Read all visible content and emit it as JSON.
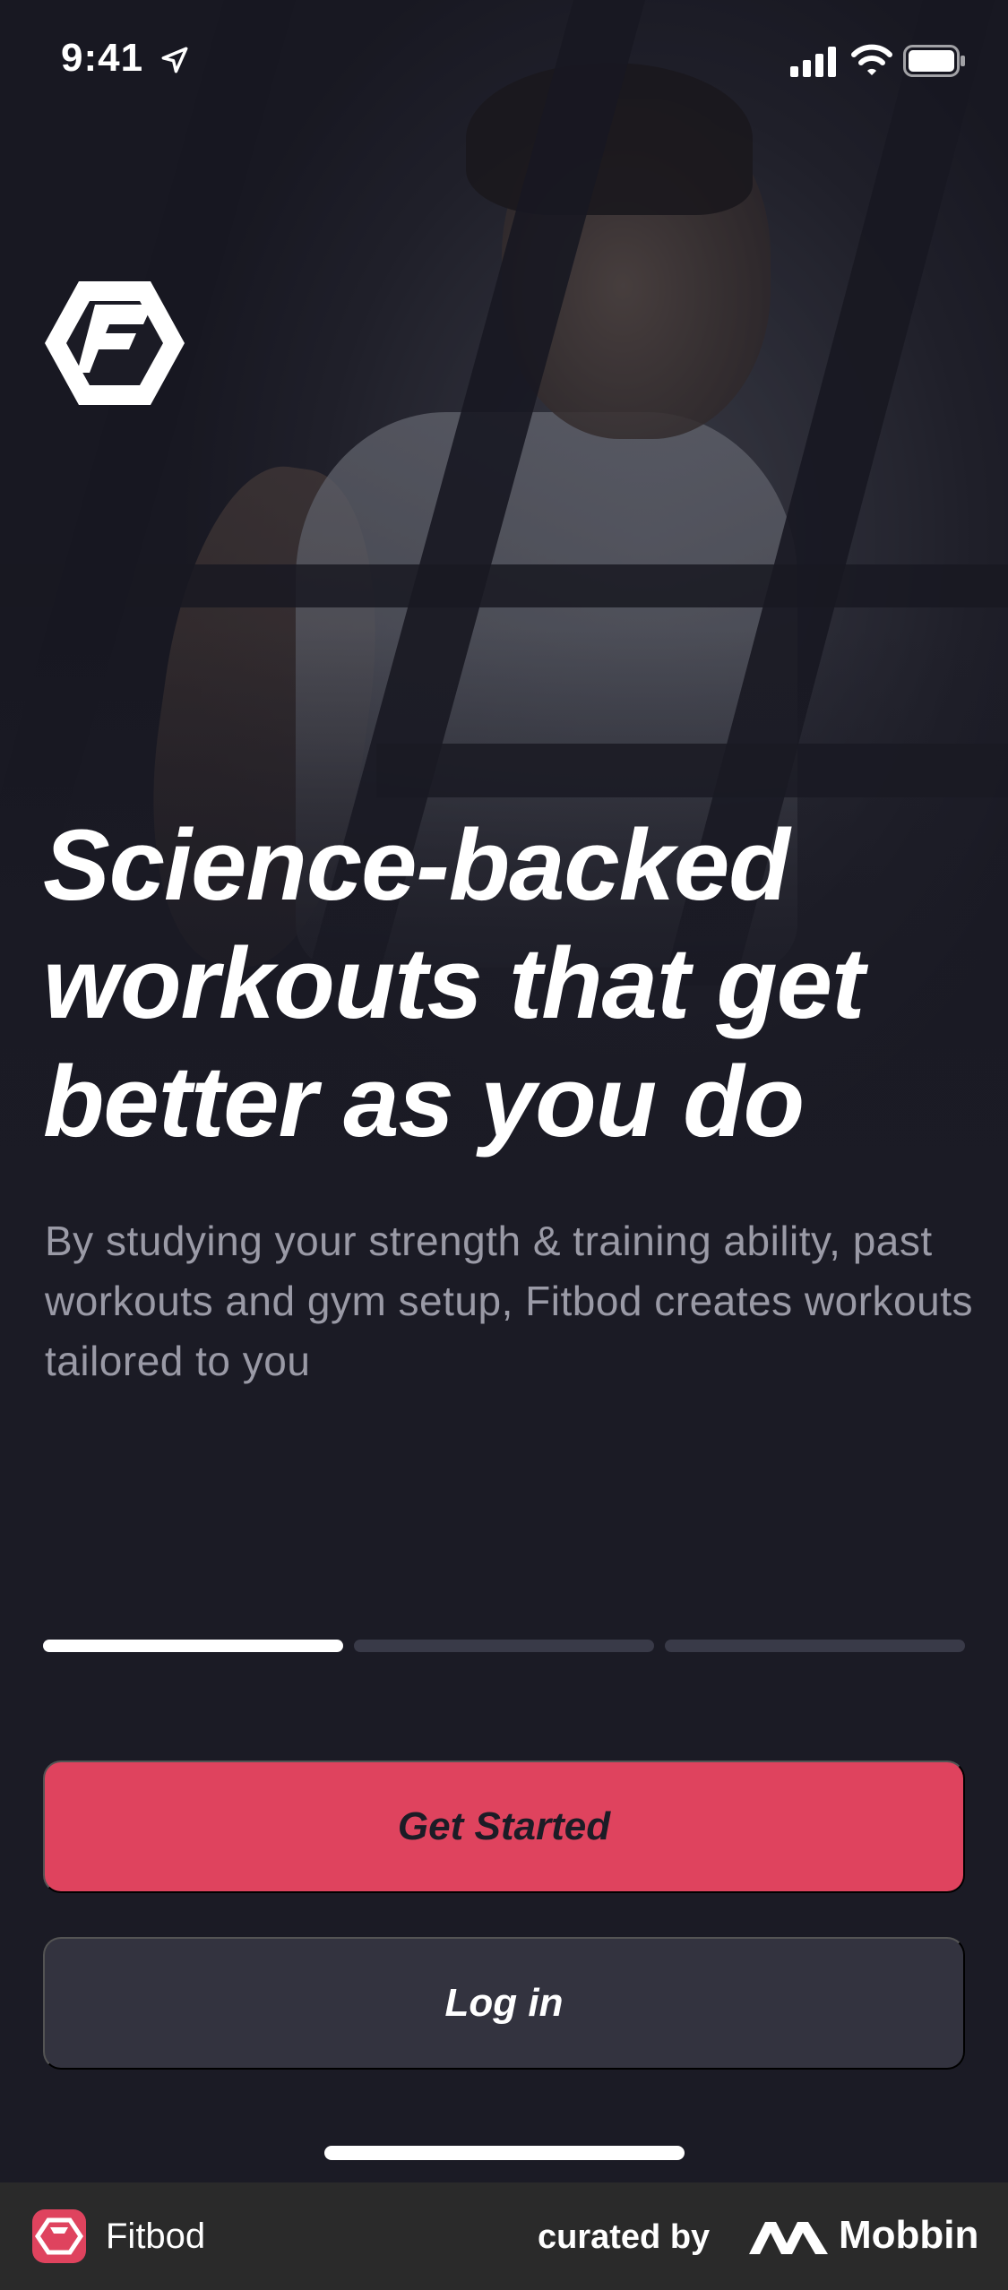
{
  "status_bar": {
    "time": "9:41",
    "icons": [
      "location-arrow-icon",
      "cellular-signal-icon",
      "wifi-icon",
      "battery-icon"
    ]
  },
  "brand": {
    "logo_icon": "fitbod-hexagon-logo-icon",
    "accent_color": "#df435e"
  },
  "hero": {
    "headline": "Science-backed workouts that get better as you do",
    "description": "By studying your strength & training ability, past workouts and gym setup, Fitbod creates workouts tailored to you"
  },
  "pager": {
    "total": 3,
    "active_index": 0
  },
  "actions": {
    "primary_label": "Get Started",
    "secondary_label": "Log in"
  },
  "footer": {
    "app_name": "Fitbod",
    "curated_label": "curated by",
    "curator_name": "Mobbin"
  },
  "colors": {
    "background": "#1b1b25",
    "primary_button": "#df435e",
    "secondary_button": "#33333f",
    "pager_inactive": "#393a48",
    "subtext": "#9a9aa6"
  }
}
